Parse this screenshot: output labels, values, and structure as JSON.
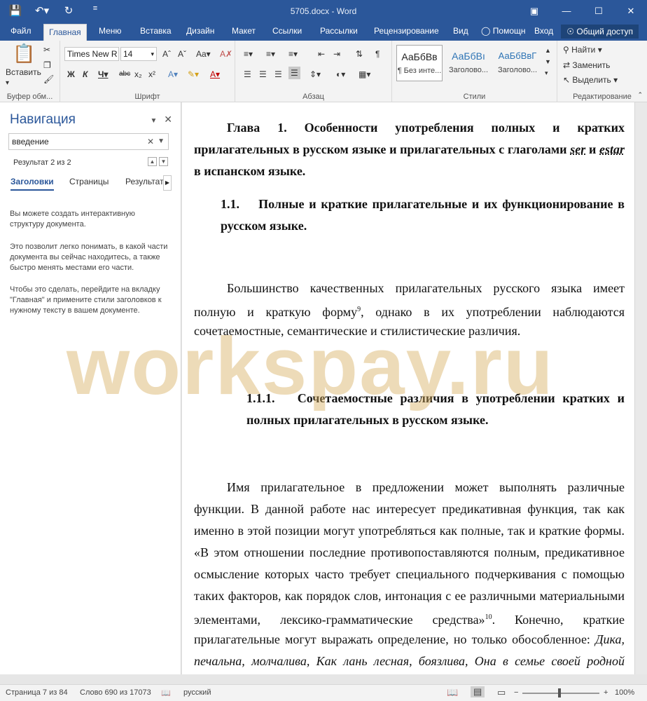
{
  "titlebar": {
    "title": "5705.docx - Word",
    "save_icon": "save-icon",
    "undo_icon": "undo-icon",
    "redo_icon": "redo-icon"
  },
  "tabs": {
    "file": "Файл",
    "home": "Главная",
    "menu": "Меню",
    "insert": "Вставка",
    "design": "Дизайн",
    "layout": "Макет",
    "references": "Ссылки",
    "mailings": "Рассылки",
    "review": "Рецензирование",
    "view": "Вид",
    "help": "Помощн",
    "signin": "Вход",
    "share": "Общий доступ"
  },
  "ribbon": {
    "clipboard": {
      "paste": "Вставить",
      "label": "Буфер обм..."
    },
    "font": {
      "name": "Times New R",
      "size": "14",
      "label": "Шрифт"
    },
    "paragraph": {
      "label": "Абзац"
    },
    "styles": {
      "label": "Стили",
      "items": [
        {
          "sample": "АаБбВв",
          "name": "¶ Без инте..."
        },
        {
          "sample": "АаБбВı",
          "name": "Заголово..."
        },
        {
          "sample": "АаБбВвГ",
          "name": "Заголово..."
        }
      ]
    },
    "editing": {
      "label": "Редактирование",
      "find": "Найти",
      "replace": "Заменить",
      "select": "Выделить"
    }
  },
  "nav": {
    "title": "Навигация",
    "search_value": "введение",
    "result": "Результат 2 из 2",
    "tabs": {
      "headings": "Заголовки",
      "pages": "Страницы",
      "results": "Результаты"
    },
    "help1": "Вы можете создать интерактивную структуру документа.",
    "help2": "Это позволит легко понимать, в какой части документа вы сейчас находитесь, а также быстро менять местами его части.",
    "help3": "Чтобы это сделать, перейдите на вкладку \"Главная\" и примените стили заголовков к нужному тексту в вашем документе."
  },
  "doc": {
    "h1_l1": "Глава 1. Особенности употребления полных и кратких",
    "h1_l2a": "прилагательных в русском языке и прилагательных с глаголами ",
    "h1_l2_ser": "ser",
    "h1_l2_and": " и ",
    "h1_l2_estar": "estar",
    "h1_l3": "в испанском языке.",
    "h2_l1": "1.1.    Полные и краткие прилагательные и их функционирование в",
    "h2_l2": "русском языке.",
    "p1_l1": "Большинство качественных прилагательных русского языка имеет",
    "p1_l2a": "полную и краткую форму",
    "p1_fn": "9",
    "p1_l2b": ", однако в их употреблении наблюдаются",
    "p1_l3": "сочетаемостные, семантические и стилистические различия.",
    "h3_l1": "1.1.1.   Сочетаемостные различия в употреблении кратких и",
    "h3_l2": "полных прилагательных в русском языке.",
    "p2_l1": "Имя прилагательное в предложении может выполнять различные",
    "p2_l2": "функции. В данной работе нас интересует предикативная функция, так как",
    "p2_l3": "именно в этой позиции могут употребляться как полные, так и краткие формы.",
    "p2_l4": "«В этом отношении последние противопоставляются полным, предикативное",
    "p2_l5": "осмысление которых часто требует специального подчеркивания с помощью",
    "p2_l6": "таких факторов, как порядок слов, интонация с ее различными материальными",
    "p2_l7a": "элементами, лексико-грамматические средства»",
    "p2_fn": "10",
    "p2_l7b": ". Конечно, краткие",
    "p2_l8a": "прилагательные могут выражать определение, но только обособленное: ",
    "p2_l8b": "Дика,",
    "p2_l9": "печальна, молчалива, Как лань лесная, боязлива, Она в семье своей родной"
  },
  "watermark": "workspay.ru",
  "status": {
    "page": "Страница 7 из 84",
    "words": "Слово 690 из 17073",
    "lang": "русский",
    "zoom": "100%"
  }
}
